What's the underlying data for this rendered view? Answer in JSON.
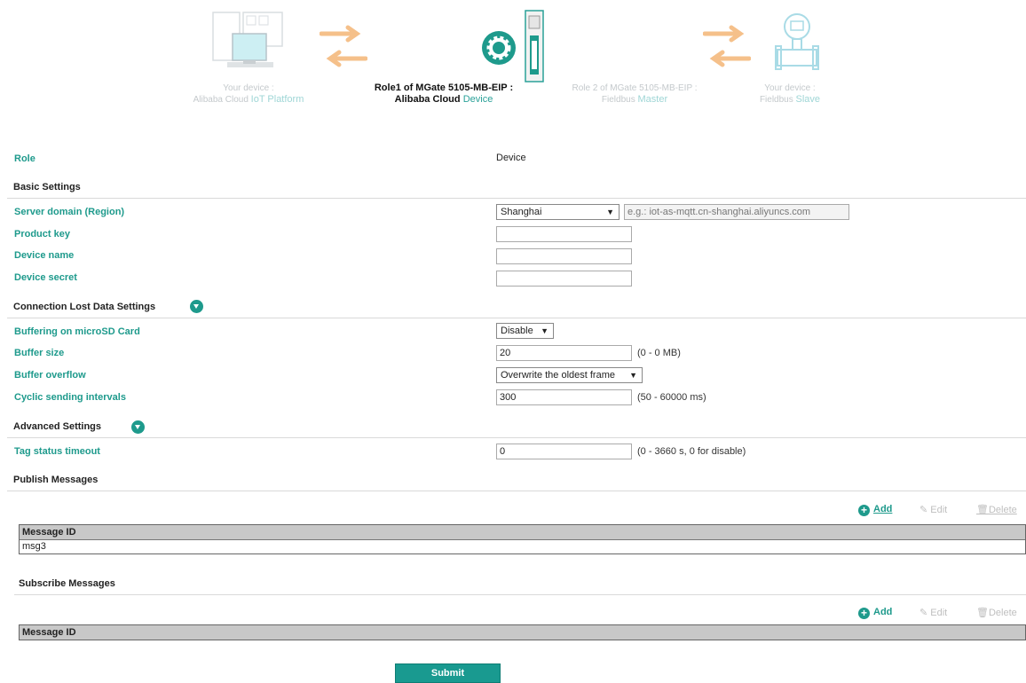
{
  "diagram": {
    "left_device": {
      "line1": "Your device :",
      "line2": "Alibaba Cloud",
      "highlight": "IoT Platform"
    },
    "role1": {
      "line1": "Role1 of MGate 5105-MB-EIP :",
      "line2": "Alibaba Cloud",
      "highlight": "Device"
    },
    "role2": {
      "line1": "Role 2 of MGate 5105-MB-EIP :",
      "line2": "Fieldbus",
      "highlight": "Master"
    },
    "right_device": {
      "line1": "Your device :",
      "line2": "Fieldbus",
      "highlight": "Slave"
    }
  },
  "role": {
    "label": "Role",
    "value": "Device"
  },
  "basic": {
    "title": "Basic Settings",
    "server_domain": {
      "label": "Server domain (Region)",
      "selected": "Shanghai",
      "placeholder": "e.g.: iot-as-mqtt.cn-shanghai.aliyuncs.com"
    },
    "product_key": {
      "label": "Product key",
      "value": ""
    },
    "device_name": {
      "label": "Device name",
      "value": ""
    },
    "device_secret": {
      "label": "Device secret",
      "value": ""
    }
  },
  "conn_lost": {
    "title": "Connection Lost Data Settings",
    "buffering": {
      "label": "Buffering on microSD Card",
      "selected": "Disable"
    },
    "buffer_size": {
      "label": "Buffer size",
      "value": "20",
      "hint": "(0 - 0 MB)"
    },
    "buffer_overflow": {
      "label": "Buffer overflow",
      "selected": "Overwrite the oldest frame"
    },
    "cyclic": {
      "label": "Cyclic sending intervals",
      "value": "300",
      "hint": "(50 - 60000 ms)"
    }
  },
  "advanced": {
    "title": "Advanced Settings",
    "tag_timeout": {
      "label": "Tag status timeout",
      "value": "0",
      "hint": "(0 - 3660 s, 0 for disable)"
    }
  },
  "publish": {
    "title": "Publish Messages",
    "add": "Add",
    "edit": "Edit",
    "delete": "Delete",
    "column": "Message ID",
    "rows": [
      "msg3"
    ]
  },
  "subscribe": {
    "title": "Subscribe Messages",
    "add": "Add",
    "edit": "Edit",
    "delete": "Delete",
    "column": "Message ID"
  },
  "submit_label": "Submit",
  "colors": {
    "accent": "#1e9a8c",
    "arrow": "#f5c08a",
    "faded": "#c4c9cc"
  },
  "icons": [
    "computer-icon",
    "arrow-right-icon",
    "arrow-left-icon",
    "gear-icon",
    "gateway-device-icon",
    "flowmeter-icon",
    "caret-down-icon",
    "plus-circle-icon",
    "pencil-icon",
    "trash-icon"
  ]
}
